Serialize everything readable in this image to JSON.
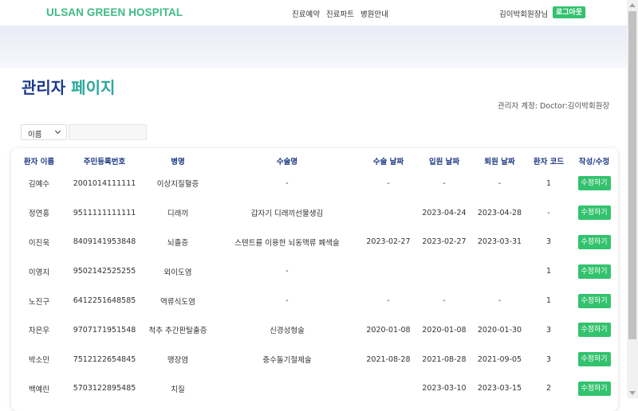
{
  "header": {
    "logo": "ULSAN GREEN HOSPITAL",
    "nav": [
      "진료예약",
      "진료파트",
      "병원안내"
    ],
    "user_name": "김이박회원장님",
    "logout_label": "로그아웃"
  },
  "page": {
    "title_part1": "관리자",
    "title_part2": "페이지",
    "account_info": "관리자 계정: Doctor:김이박회원장"
  },
  "search": {
    "field_selected": "이름",
    "query_value": ""
  },
  "table": {
    "columns": [
      "환자 이름",
      "주민등록번호",
      "병명",
      "수술명",
      "수술 날짜",
      "입원 날짜",
      "퇴원 날짜",
      "환자 코드",
      "작성/수정"
    ],
    "edit_label": "수정하기",
    "rows": [
      {
        "name": "김예수",
        "rrn": "2001014111111",
        "disease": "이상지질혈증",
        "surgery": "-",
        "surgery_date": "-",
        "admit_date": "-",
        "discharge_date": "-",
        "code": "1"
      },
      {
        "name": "정연홍",
        "rrn": "9511111111111",
        "disease": "디래끼",
        "surgery": "갑자기 디래끼선물생김",
        "surgery_date": "",
        "admit_date": "2023-04-24",
        "discharge_date": "2023-04-28",
        "code": "-"
      },
      {
        "name": "이진욱",
        "rrn": "8409141953848",
        "disease": "뇌졸증",
        "surgery": "스텐트를 이용한 뇌동맥류 폐색술",
        "surgery_date": "2023-02-27",
        "admit_date": "2023-02-27",
        "discharge_date": "2023-03-31",
        "code": "3"
      },
      {
        "name": "이영지",
        "rrn": "9502142525255",
        "disease": "외이도염",
        "surgery": "-",
        "surgery_date": "",
        "admit_date": "",
        "discharge_date": "",
        "code": "1"
      },
      {
        "name": "노진구",
        "rrn": "6412251648585",
        "disease": "역류식도염",
        "surgery": "-",
        "surgery_date": "-",
        "admit_date": "-",
        "discharge_date": "-",
        "code": "1"
      },
      {
        "name": "차은우",
        "rrn": "9707171951548",
        "disease": "척추 추간판탈출증",
        "surgery": "신경성형술",
        "surgery_date": "2020-01-08",
        "admit_date": "2020-01-08",
        "discharge_date": "2020-01-30",
        "code": "3"
      },
      {
        "name": "박소민",
        "rrn": "7512122654845",
        "disease": "맹장염",
        "surgery": "충수돌기절제술",
        "surgery_date": "2021-08-28",
        "admit_date": "2021-08-28",
        "discharge_date": "2021-09-05",
        "code": "3"
      },
      {
        "name": "백예린",
        "rrn": "5703122895485",
        "disease": "치질",
        "surgery": "",
        "surgery_date": "",
        "admit_date": "2023-03-10",
        "discharge_date": "2023-03-15",
        "code": "2"
      }
    ]
  },
  "colors": {
    "brand_green": "#3dbb85",
    "button_green": "#33c26e",
    "title_navy": "#1a3a8f",
    "title_teal": "#2aa89a",
    "header_text_navy": "#1f3b86"
  }
}
